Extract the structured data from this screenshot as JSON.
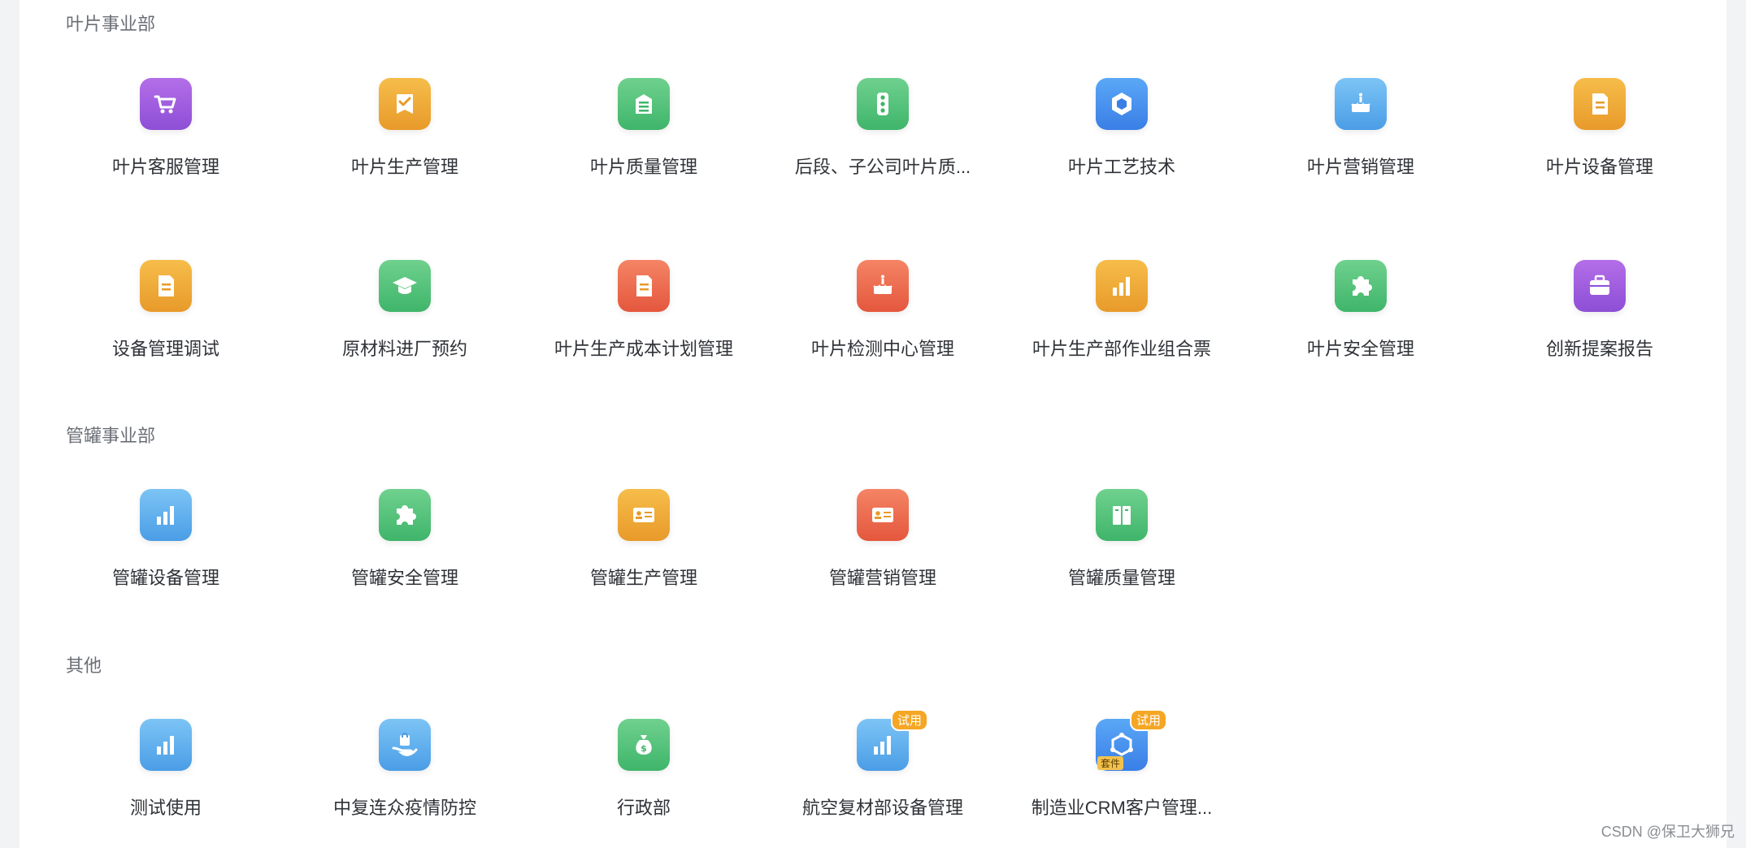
{
  "colors": {
    "purple": "#9b5de0",
    "orange": "#eda735",
    "green": "#4fbf77",
    "blue": "#4a8fee",
    "sky": "#5aaeec",
    "red": "#ea6a4d",
    "badge": "#f5a623"
  },
  "sections": [
    {
      "title": "叶片事业部",
      "apps": [
        {
          "label": "叶片客服管理",
          "icon": "cart-icon",
          "color": "purple"
        },
        {
          "label": "叶片生产管理",
          "icon": "checklist-icon",
          "color": "orange"
        },
        {
          "label": "叶片质量管理",
          "icon": "document-icon",
          "color": "green"
        },
        {
          "label": "后段、子公司叶片质...",
          "icon": "traffic-light-icon",
          "color": "green"
        },
        {
          "label": "叶片工艺技术",
          "icon": "cube-icon",
          "color": "blue"
        },
        {
          "label": "叶片营销管理",
          "icon": "cake-icon",
          "color": "sky"
        },
        {
          "label": "叶片设备管理",
          "icon": "note-icon",
          "color": "orange"
        },
        {
          "label": "设备管理调试",
          "icon": "note-icon",
          "color": "orange"
        },
        {
          "label": "原材料进厂预约",
          "icon": "graduation-cap-icon",
          "color": "green"
        },
        {
          "label": "叶片生产成本计划管理",
          "icon": "note-icon",
          "color": "red"
        },
        {
          "label": "叶片检测中心管理",
          "icon": "cake-icon",
          "color": "red"
        },
        {
          "label": "叶片生产部作业组合票",
          "icon": "bar-chart-icon",
          "color": "orange"
        },
        {
          "label": "叶片安全管理",
          "icon": "puzzle-icon",
          "color": "green"
        },
        {
          "label": "创新提案报告",
          "icon": "briefcase-icon",
          "color": "purple"
        }
      ]
    },
    {
      "title": "管罐事业部",
      "apps": [
        {
          "label": "管罐设备管理",
          "icon": "bar-chart-icon",
          "color": "sky"
        },
        {
          "label": "管罐安全管理",
          "icon": "puzzle-icon",
          "color": "green"
        },
        {
          "label": "管罐生产管理",
          "icon": "id-card-icon",
          "color": "orange"
        },
        {
          "label": "管罐营销管理",
          "icon": "id-card-icon",
          "color": "red"
        },
        {
          "label": "管罐质量管理",
          "icon": "book-icon",
          "color": "green"
        }
      ]
    },
    {
      "title": "其他",
      "apps": [
        {
          "label": "测试使用",
          "icon": "bar-chart-icon",
          "color": "sky"
        },
        {
          "label": "中复连众疫情防控",
          "icon": "hand-bag-icon",
          "color": "sky"
        },
        {
          "label": "行政部",
          "icon": "money-bag-icon",
          "color": "green"
        },
        {
          "label": "航空复材部设备管理",
          "icon": "bar-chart-icon",
          "color": "sky",
          "badge": "试用"
        },
        {
          "label": "制造业CRM客户管理...",
          "icon": "network-icon",
          "color": "blue",
          "badge": "试用",
          "kit": "套件"
        }
      ]
    }
  ],
  "watermark": "CSDN @保卫大狮兄"
}
